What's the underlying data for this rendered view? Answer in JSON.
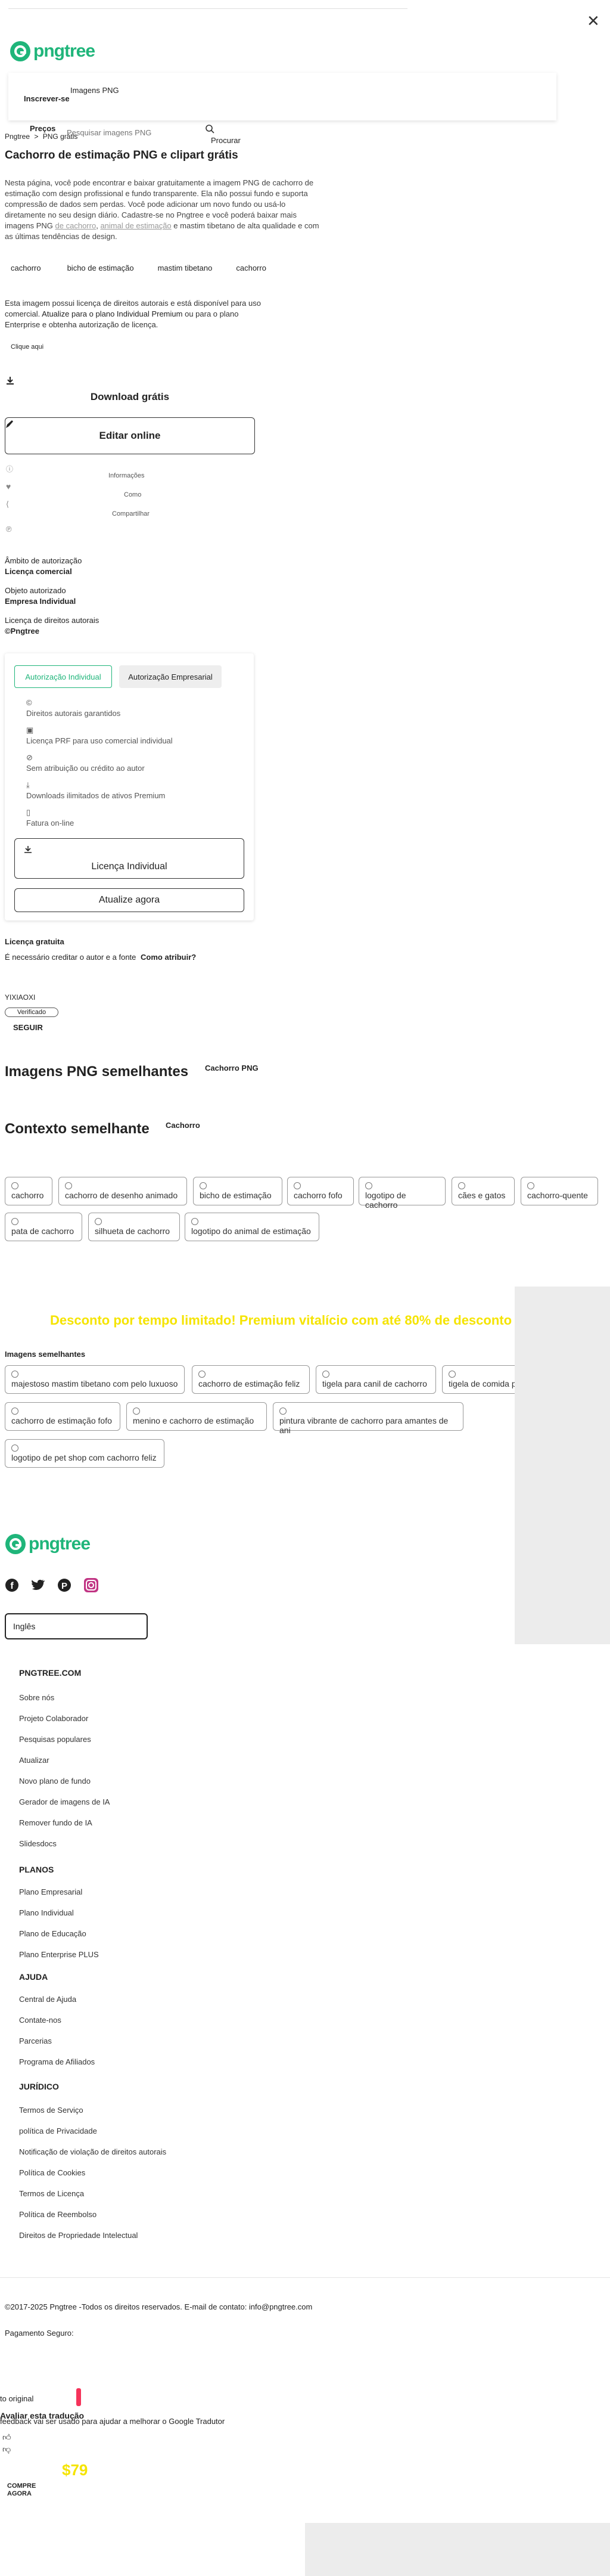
{
  "header": {
    "logo_text": "pngtree",
    "menu_label": "Imagens PNG",
    "login_label": "Inscrever-se",
    "prices_label": "Preços",
    "search_placeholder": "Pesquisar imagens PNG",
    "search_button": "Procurar"
  },
  "breadcrumb": {
    "home": "Pngtree",
    "sep": ">",
    "current": "PNG grátis"
  },
  "page_title": "Cachorro de estimação PNG e clipart grátis",
  "description": {
    "text_1": "Nesta página, você pode encontrar e baixar gratuitamente a imagem PNG de cachorro de estimação com design profissional e fundo transparente. Ela não possui fundo e suporta compressão de dados sem perdas. Você pode adicionar um novo fundo ou usá-lo diretamente no seu design diário. Cadastre-se no Pngtree e você poderá baixar mais imagens PNG",
    "link_1": "de cachorro",
    "link_2": "animal de estimação",
    "text_2": "e",
    "link_3": "mastim tibetano",
    "text_3": "de alta qualidade e com as últimas tendências de design."
  },
  "tags": [
    "cachorro",
    "bicho de estimação",
    "mastim tibetano",
    "cachorro"
  ],
  "license_notice": {
    "text_1": "Esta imagem possui licença de direitos autorais e está disponível para uso comercial.",
    "link_1": "Atualize para o plano Individual Premium",
    "text_2": "ou para o plano Enterprise",
    "text_3": "e obtenha autorização de licença.",
    "click_here": "Clique aqui"
  },
  "actions": {
    "download_free": "Download grátis",
    "edit_online": "Editar online",
    "info": "Informações",
    "like": "Como",
    "share": "Compartilhar"
  },
  "license_info": {
    "scope_label": "Âmbito de autorização",
    "scope_value": "Licença comercial",
    "object_label": "Objeto autorizado",
    "object_value": "Empresa Individual",
    "copyright_label": "Licença de direitos autorais",
    "copyright_value": "©Pngtree"
  },
  "license_tabs": {
    "individual": "Autorização Individual",
    "enterprise": "Autorização Empresarial",
    "features": [
      "Direitos autorais garantidos",
      "Licença PRF para uso comercial individual",
      "Sem atribuição ou crédito ao autor",
      "Downloads ilimitados de ativos Premium",
      "Fatura on-line"
    ],
    "individual_button": "Licença Individual",
    "upgrade_button": "Atualize agora"
  },
  "free_license": {
    "title": "Licença gratuita",
    "text": "É necessário creditar o autor e a fonte",
    "link": "Como atribuir?"
  },
  "author": {
    "name": "YIXIAOXI",
    "badge": "Verificado",
    "follow": "SEGUIR"
  },
  "similar_png": {
    "title": "Imagens PNG semelhantes",
    "tag": "Cachorro PNG"
  },
  "similar_context": {
    "title": "Contexto semelhante",
    "tag": "Cachorro",
    "chips": [
      "cachorro",
      "cachorro de desenho animado",
      "bicho de estimação",
      "cachorro fofo",
      "logotipo de cachorro",
      "cães e gatos",
      "cachorro-quente",
      "pata de cachorro",
      "silhueta de cachorro",
      "logotipo do animal de estimação"
    ]
  },
  "promo": {
    "text": "Desconto por tempo limitado! Premium vitalício com até 80% de desconto"
  },
  "similar_images": {
    "title": "Imagens semelhantes",
    "chips": [
      "majestoso mastim tibetano com pelo luxuoso",
      "cachorro de estimação feliz",
      "tigela para canil de cachorro",
      "tigela de comida p",
      "cachorro de estimação fofo",
      "menino e cachorro de estimação",
      "pintura vibrante de cachorro para amantes de ani",
      "logotipo de pet shop com cachorro feliz"
    ]
  },
  "footer": {
    "logo_text": "pngtree",
    "language": "Inglês",
    "sections": [
      {
        "title": "PNGTREE.COM",
        "links": [
          "Sobre nós",
          "Projeto Colaborador",
          "Pesquisas populares",
          "Atualizar",
          "Novo plano de fundo",
          "Gerador de imagens de IA",
          "Remover fundo de IA",
          "Slidesdocs"
        ]
      },
      {
        "title": "PLANOS",
        "links": [
          "Plano Empresarial",
          "Plano Individual",
          "Plano de Educação",
          "Plano Enterprise PLUS"
        ]
      },
      {
        "title": "AJUDA",
        "links": [
          "Central de Ajuda",
          "Contate-nos",
          "Parcerias",
          "Programa de Afiliados"
        ]
      },
      {
        "title": "JURÍDICO",
        "links": [
          "Termos de Serviço",
          "política de Privacidade",
          "Notificação de violação de direitos autorais",
          "Política de Cookies",
          "Termos de Licença",
          "Política de Reembolso",
          "Direitos de Propriedade Intelectual"
        ]
      }
    ],
    "copyright": "©2017-2025 Pngtree -Todos os direitos reservados. E-mail de contato: info@pngtree.com",
    "secure_payment": "Pagamento Seguro:"
  },
  "translate_popup": {
    "original": "to original",
    "rate": "Avaliar esta tradução",
    "feedback": "feedback vai ser usado para ajudar a melhorar o Google Tradutor"
  },
  "bottom_promo": {
    "price": "$79",
    "buy": "COMPRE AGORA"
  },
  "colors": {
    "brand_green": "#1fb57a",
    "promo_yellow": "#f5e400",
    "accent_red": "#f5335a"
  }
}
